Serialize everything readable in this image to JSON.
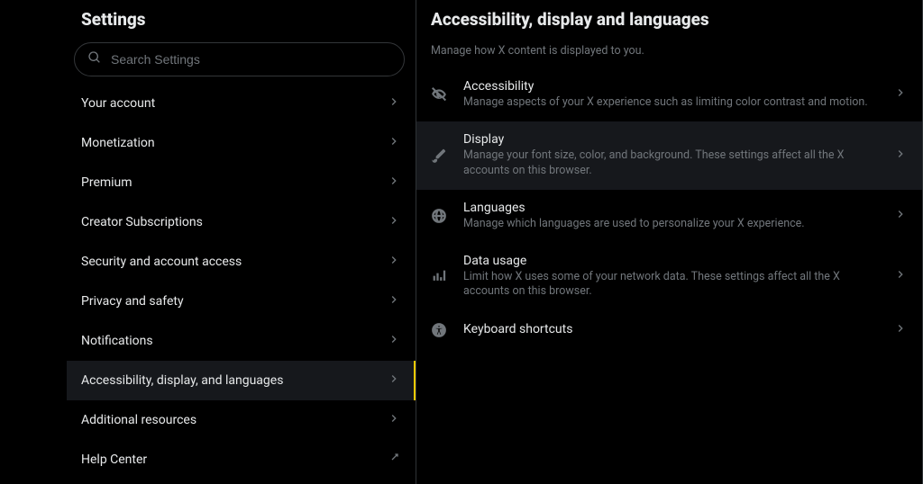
{
  "sidebar": {
    "title": "Settings",
    "search_placeholder": "Search Settings",
    "items": [
      {
        "label": "Your account",
        "selected": false,
        "external": false
      },
      {
        "label": "Monetization",
        "selected": false,
        "external": false
      },
      {
        "label": "Premium",
        "selected": false,
        "external": false
      },
      {
        "label": "Creator Subscriptions",
        "selected": false,
        "external": false
      },
      {
        "label": "Security and account access",
        "selected": false,
        "external": false
      },
      {
        "label": "Privacy and safety",
        "selected": false,
        "external": false
      },
      {
        "label": "Notifications",
        "selected": false,
        "external": false
      },
      {
        "label": "Accessibility, display, and languages",
        "selected": true,
        "external": false
      },
      {
        "label": "Additional resources",
        "selected": false,
        "external": false
      },
      {
        "label": "Help Center",
        "selected": false,
        "external": true
      }
    ]
  },
  "detail": {
    "title": "Accessibility, display and languages",
    "subtitle": "Manage how X content is displayed to you.",
    "options": [
      {
        "icon": "eye-off-icon",
        "title": "Accessibility",
        "desc": "Manage aspects of your X experience such as limiting color contrast and motion.",
        "selected": false
      },
      {
        "icon": "brush-icon",
        "title": "Display",
        "desc": "Manage your font size, color, and background. These settings affect all the X accounts on this browser.",
        "selected": true
      },
      {
        "icon": "globe-icon",
        "title": "Languages",
        "desc": "Manage which languages are used to personalize your X experience.",
        "selected": false
      },
      {
        "icon": "bars-icon",
        "title": "Data usage",
        "desc": "Limit how X uses some of your network data. These settings affect all the X accounts on this browser.",
        "selected": false
      },
      {
        "icon": "accessibility-person-icon",
        "title": "Keyboard shortcuts",
        "desc": "",
        "selected": false
      }
    ]
  }
}
